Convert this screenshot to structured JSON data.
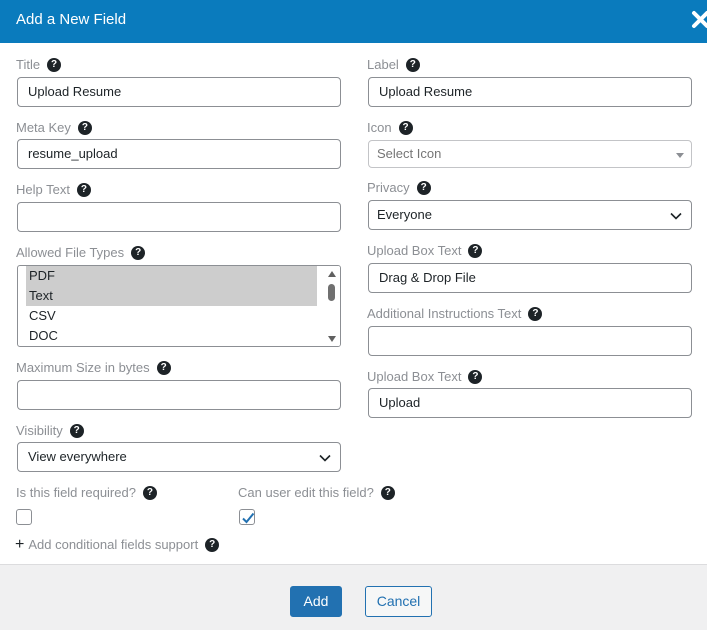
{
  "header": {
    "title": "Add a New Field"
  },
  "help_icon_glyph": "?",
  "fields": {
    "title": {
      "label": "Title",
      "value": "Upload Resume"
    },
    "label": {
      "label": "Label",
      "value": "Upload Resume"
    },
    "meta_key": {
      "label": "Meta Key",
      "value": "resume_upload"
    },
    "icon": {
      "label": "Icon",
      "placeholder": "Select Icon"
    },
    "help_text": {
      "label": "Help Text",
      "value": ""
    },
    "privacy": {
      "label": "Privacy",
      "value": "Everyone"
    },
    "allowed_file_types": {
      "label": "Allowed File Types",
      "options": [
        {
          "label": "PDF",
          "selected": true
        },
        {
          "label": "Text",
          "selected": true
        },
        {
          "label": "CSV",
          "selected": false
        },
        {
          "label": "DOC",
          "selected": false
        }
      ]
    },
    "upload_box_text": {
      "label": "Upload Box Text",
      "value": "Drag & Drop File"
    },
    "additional_instructions": {
      "label": "Additional Instructions Text",
      "value": ""
    },
    "max_size": {
      "label": "Maximum Size in bytes",
      "value": ""
    },
    "upload_box_text_2": {
      "label": "Upload Box Text",
      "value": "Upload"
    },
    "visibility": {
      "label": "Visibility",
      "value": "View everywhere"
    },
    "required": {
      "label": "Is this field required?",
      "checked": false
    },
    "editable": {
      "label": "Can user edit this field?",
      "checked": true
    }
  },
  "conditional": {
    "label": "Add conditional fields support",
    "icon": "plus-icon"
  },
  "footer": {
    "add_label": "Add",
    "cancel_label": "Cancel"
  },
  "colors": {
    "header_bg": "#0a7bbd",
    "primary": "#2271b1",
    "footer_bg": "#f0f0f1",
    "muted_text": "#8c8f94"
  }
}
